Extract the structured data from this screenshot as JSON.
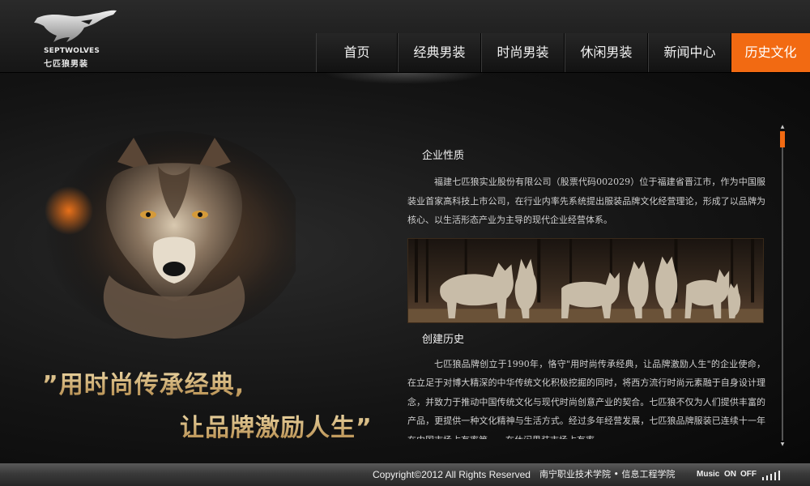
{
  "logo": {
    "brand_en": "SEPTWOLVES",
    "brand_cn": "七匹狼男装"
  },
  "nav": {
    "items": [
      {
        "label": "首页",
        "active": false
      },
      {
        "label": "经典男装",
        "active": false
      },
      {
        "label": "时尚男装",
        "active": false
      },
      {
        "label": "休闲男装",
        "active": false
      },
      {
        "label": "新闻中心",
        "active": false
      },
      {
        "label": "历史文化",
        "active": true
      }
    ],
    "active_color": "#f26a12"
  },
  "slogan": {
    "line1": "”用时尚传承经典,",
    "line2": "让品牌激励人生”"
  },
  "article": {
    "section1": {
      "title": "企业性质",
      "body": "福建七匹狼实业股份有限公司（股票代码002029）位于福建省晋江市，作为中国服装业首家高科技上市公司，在行业内率先系统提出服装品牌文化经营理论，形成了以品牌为核心、以生活形态产业为主导的现代企业经营体系。"
    },
    "section2": {
      "title": "创建历史",
      "body": "七匹狼品牌创立于1990年，恪守\"用时尚传承经典，让品牌激励人生\"的企业使命，在立足于对博大精深的中华传统文化积极挖掘的同时，将西方流行时尚元素融于自身设计理念，并致力于推动中国传统文化与现代时尚创意产业的契合。七匹狼不仅为人们提供丰富的产品，更提供一种文化精神与生活方式。经过多年经营发展，七匹狼品牌服装已连续十一年在中国市场占有率第一，在休闲男装市场占有率"
    }
  },
  "footer": {
    "copyright": "Copyright©2012 All Rights Reserved",
    "school": "南宁职业技术学院 • 信息工程学院",
    "music_label": "Music",
    "music_on": "ON",
    "music_off": "OFF"
  },
  "colors": {
    "accent": "#f26a12",
    "background": "#0b0b0b",
    "text": "#cfcfcf"
  },
  "icons": [
    "wolf-logo-icon",
    "scroll-up-icon",
    "scroll-down-icon",
    "equalizer-icon"
  ]
}
